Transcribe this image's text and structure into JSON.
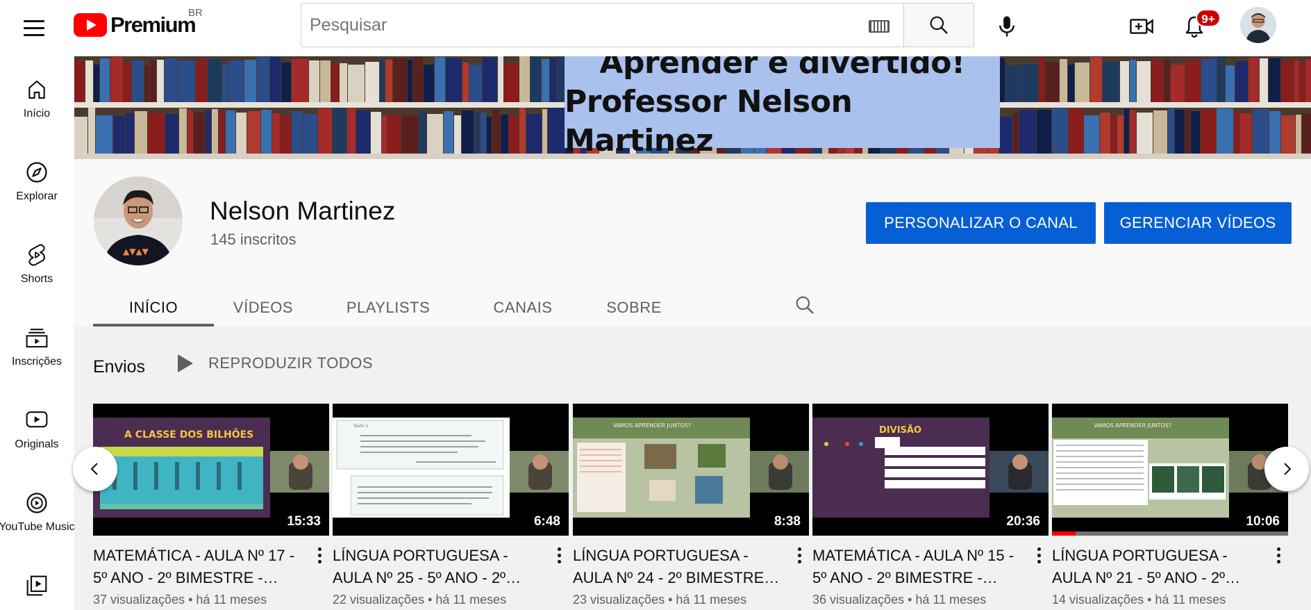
{
  "header": {
    "logo_text": "Premium",
    "country": "BR",
    "search_placeholder": "Pesquisar",
    "notifications_badge": "9+"
  },
  "sidebar": {
    "items": [
      {
        "label": "Início",
        "icon": "home-icon"
      },
      {
        "label": "Explorar",
        "icon": "compass-icon"
      },
      {
        "label": "Shorts",
        "icon": "shorts-icon"
      },
      {
        "label": "Inscrições",
        "icon": "subscriptions-icon"
      },
      {
        "label": "Originals",
        "icon": "originals-icon"
      },
      {
        "label": "YouTube Music",
        "icon": "music-icon"
      },
      {
        "label": "",
        "icon": "library-icon"
      }
    ]
  },
  "banner": {
    "line1": "Aprender é divertido!",
    "line2": "Professor Nelson Martinez"
  },
  "channel": {
    "name": "Nelson Martinez",
    "subscribers": "145 inscritos",
    "customize_label": "PERSONALIZAR O CANAL",
    "manage_label": "GERENCIAR VÍDEOS",
    "tabs": [
      "INÍCIO",
      "VÍDEOS",
      "PLAYLISTS",
      "CANAIS",
      "SOBRE"
    ]
  },
  "uploads": {
    "title": "Envios",
    "play_all": "REPRODUZIR TODOS",
    "videos": [
      {
        "title1": "MATEMÁTICA - AULA Nº 17 -",
        "title2": "5º ANO - 2º BIMESTRE -…",
        "duration": "15:33",
        "meta": "37 visualizações • há 11 meses",
        "thumb_heading": "A CLASSE DOS BILHÕES"
      },
      {
        "title1": "LÍNGUA PORTUGUESA -",
        "title2": "AULA Nº 25 - 5º ANO - 2º…",
        "duration": "6:48",
        "meta": "22 visualizações • há 11 meses",
        "thumb_heading": "Texto 1"
      },
      {
        "title1": "LÍNGUA PORTUGUESA -",
        "title2": "AULA Nº 24 - 2º BIMESTRE …",
        "duration": "8:38",
        "meta": "23 visualizações • há 11 meses",
        "thumb_heading": "VAMOS APRENDER JUNTOS?"
      },
      {
        "title1": "MATEMÁTICA - AULA Nº 15 -",
        "title2": "5º ANO - 2º BIMESTRE -…",
        "duration": "20:36",
        "meta": "36 visualizações • há 11 meses",
        "thumb_heading": "DIVISÃO"
      },
      {
        "title1": "LÍNGUA PORTUGUESA -",
        "title2": "AULA Nº 21 - 5º ANO - 2º…",
        "duration": "10:06",
        "meta": "14 visualizações • há 11 meses",
        "thumb_heading": "VAMOS APRENDER JUNTOS?",
        "watched_progress": 0.1
      }
    ]
  },
  "colors": {
    "brand_red": "#ff0000",
    "button_blue": "#065fd4",
    "badge_red": "#cc0000"
  }
}
